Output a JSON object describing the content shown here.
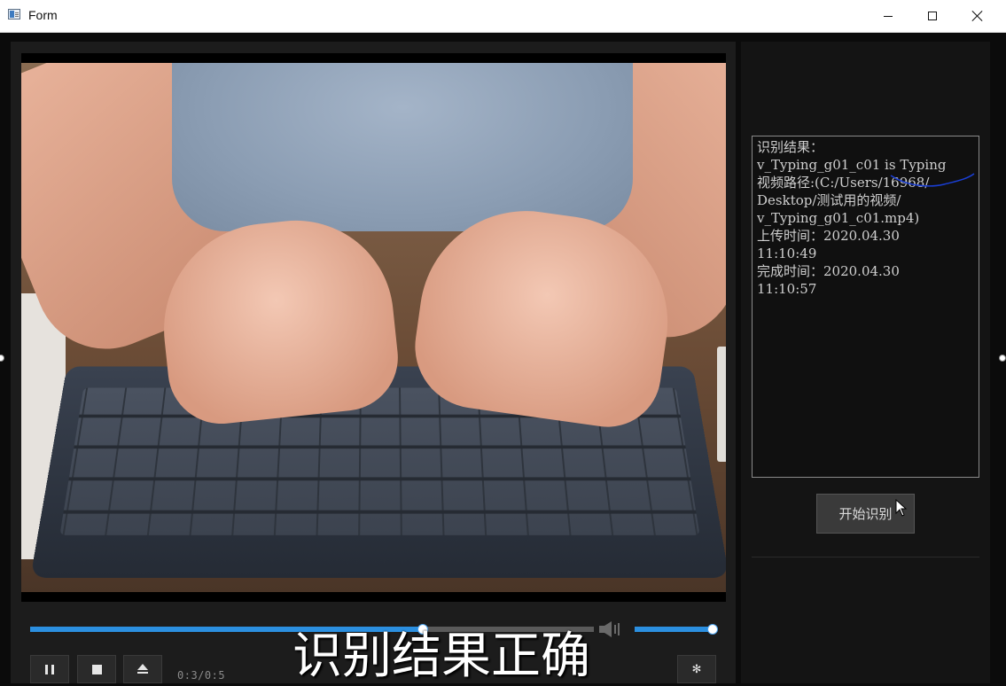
{
  "window": {
    "title": "Form",
    "controls": {
      "minimize": "minimize-icon",
      "maximize": "maximize-icon",
      "close": "close-icon"
    }
  },
  "player": {
    "time_label": "0:3/0:5",
    "seek_progress": 0.697,
    "volume_level": 1.0,
    "buttons": [
      "pause-icon",
      "stop-icon",
      "eject-icon",
      "settings-icon"
    ]
  },
  "caption": "识别结果正确",
  "result": {
    "lines": [
      "识别结果：",
      "v_Typing_g01_c01 is Typing",
      "视频路径:(C:/Users/16968/",
      "Desktop/测试用的视频/",
      "v_Typing_g01_c01.mp4)",
      "上传时间：2020.04.30",
      "11:10:49",
      "完成时间：2020.04.30",
      "11:10:57"
    ]
  },
  "start_button": {
    "label": "开始识别"
  },
  "colors": {
    "accent": "#2b8fe0",
    "panel_bg": "#1c1c1c",
    "annotation_ink": "#1a3fd6"
  }
}
